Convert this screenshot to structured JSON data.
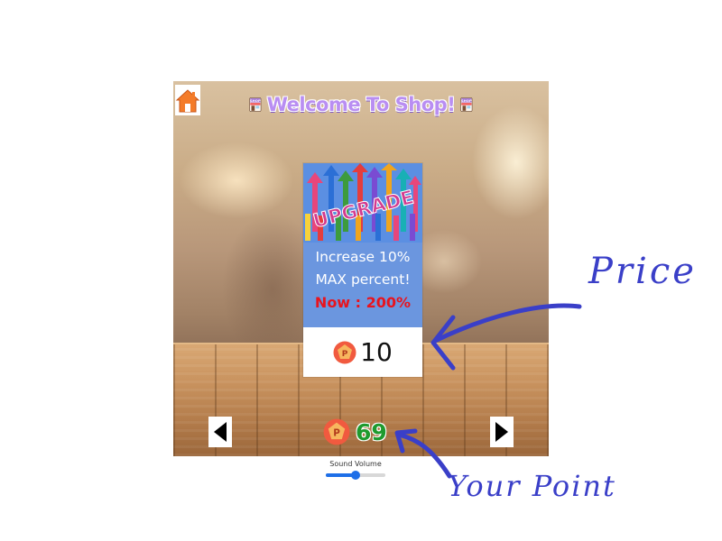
{
  "header": {
    "title": "Welcome To Shop!",
    "left_icon": "home-icon",
    "shop_icon_text": "SHOP"
  },
  "card": {
    "banner_text": "UPGRADE",
    "description_line1": "Increase 10%",
    "description_line2": "MAX percent!",
    "now_text": "Now : 200%",
    "price": "10",
    "price_icon": "point-coin-icon",
    "coin_letter": "P"
  },
  "footer": {
    "prev_icon": "arrow-left-icon",
    "next_icon": "arrow-right-icon",
    "points": "69",
    "points_icon": "point-coin-icon"
  },
  "volume": {
    "label": "Sound Volume",
    "value": 0.5
  },
  "annotations": {
    "price_label": "Price",
    "point_label": "Your Point"
  },
  "colors": {
    "title": "#b98ef2",
    "card_background": "#6b96df",
    "now_text": "#e8141e",
    "points_text": "#1f9a2e",
    "slider": "#1e6fe8",
    "annotation_ink": "#3a3fc8"
  }
}
